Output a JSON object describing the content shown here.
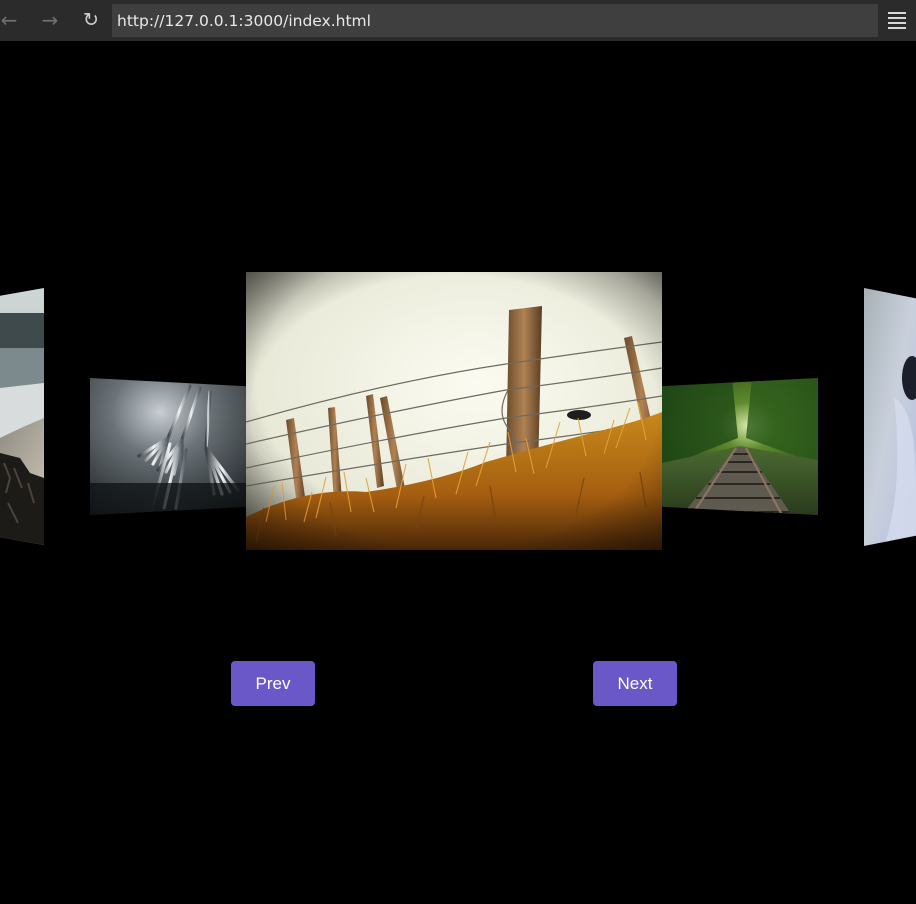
{
  "browser": {
    "url": "http://127.0.0.1:3000/index.html",
    "back_icon": "arrow-left",
    "forward_icon": "arrow-right",
    "reload_icon": "reload",
    "menu_icon": "hamburger-menu"
  },
  "carousel": {
    "slides": [
      {
        "subject": "beach shoreline"
      },
      {
        "subject": "forks"
      },
      {
        "subject": "barbed wire fence in grass field"
      },
      {
        "subject": "railway track through forest"
      },
      {
        "subject": "partial blue image"
      }
    ],
    "prev_label": "Prev",
    "next_label": "Next"
  },
  "colors": {
    "background": "#000000",
    "button": "#6a58c8",
    "toolbar": "#2b2b2b",
    "address_bar": "#3f3f3f"
  }
}
